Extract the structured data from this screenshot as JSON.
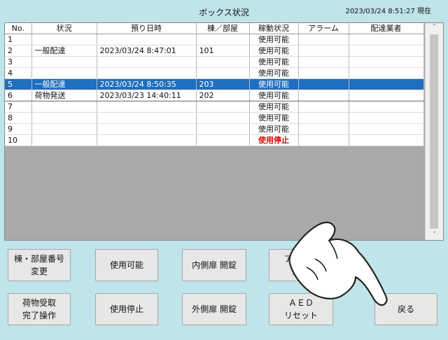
{
  "header": {
    "title": "ボックス状況",
    "clock": "2023/03/24 8:51:27 現在"
  },
  "table": {
    "columns": [
      "No.",
      "状況",
      "預り日時",
      "棟／部屋",
      "稼動状況",
      "アラーム",
      "配達業者"
    ],
    "rows": [
      {
        "no": "1",
        "status": "",
        "datetime": "",
        "room": "",
        "op": "使用可能",
        "alarm": "",
        "courier": ""
      },
      {
        "no": "2",
        "status": "一般配達",
        "datetime": "2023/03/24  8:47:01",
        "room": "101",
        "op": "使用可能",
        "alarm": "",
        "courier": ""
      },
      {
        "no": "3",
        "status": "",
        "datetime": "",
        "room": "",
        "op": "使用可能",
        "alarm": "",
        "courier": ""
      },
      {
        "no": "4",
        "status": "",
        "datetime": "",
        "room": "",
        "op": "使用可能",
        "alarm": "",
        "courier": ""
      },
      {
        "no": "5",
        "status": "一般配達",
        "datetime": "2023/03/24  8:50:35",
        "room": "203",
        "op": "使用可能",
        "alarm": "",
        "courier": ""
      },
      {
        "no": "6",
        "status": "荷物発送",
        "datetime": "2023/03/23 14:40:11",
        "room": "202",
        "op": "使用可能",
        "alarm": "",
        "courier": ""
      },
      {
        "no": "7",
        "status": "",
        "datetime": "",
        "room": "",
        "op": "使用可能",
        "alarm": "",
        "courier": ""
      },
      {
        "no": "8",
        "status": "",
        "datetime": "",
        "room": "",
        "op": "使用可能",
        "alarm": "",
        "courier": ""
      },
      {
        "no": "9",
        "status": "",
        "datetime": "",
        "room": "",
        "op": "使用可能",
        "alarm": "",
        "courier": ""
      },
      {
        "no": "10",
        "status": "",
        "datetime": "",
        "room": "",
        "op": "使用停止",
        "alarm": "",
        "courier": ""
      }
    ],
    "selected_row": "5",
    "stop_value": "使用停止"
  },
  "scrollbar": {
    "up": "˄",
    "down": "˅"
  },
  "buttons": {
    "room_change": "棟・部屋番号\n変更",
    "enable": "使用可能",
    "inner_door": "内側扉 開錠",
    "alarm_release": "アラーム\n解除",
    "receive_done": "荷物受取\n完了操作",
    "disable": "使用停止",
    "outer_door": "外側扉 開錠",
    "aed_reset": "ＡＥＤ\nリセット",
    "back": "戻る"
  },
  "colors": {
    "selected_row": "#1f6ec0",
    "stop_text": "#e00000",
    "background": "#bfe4ea"
  }
}
